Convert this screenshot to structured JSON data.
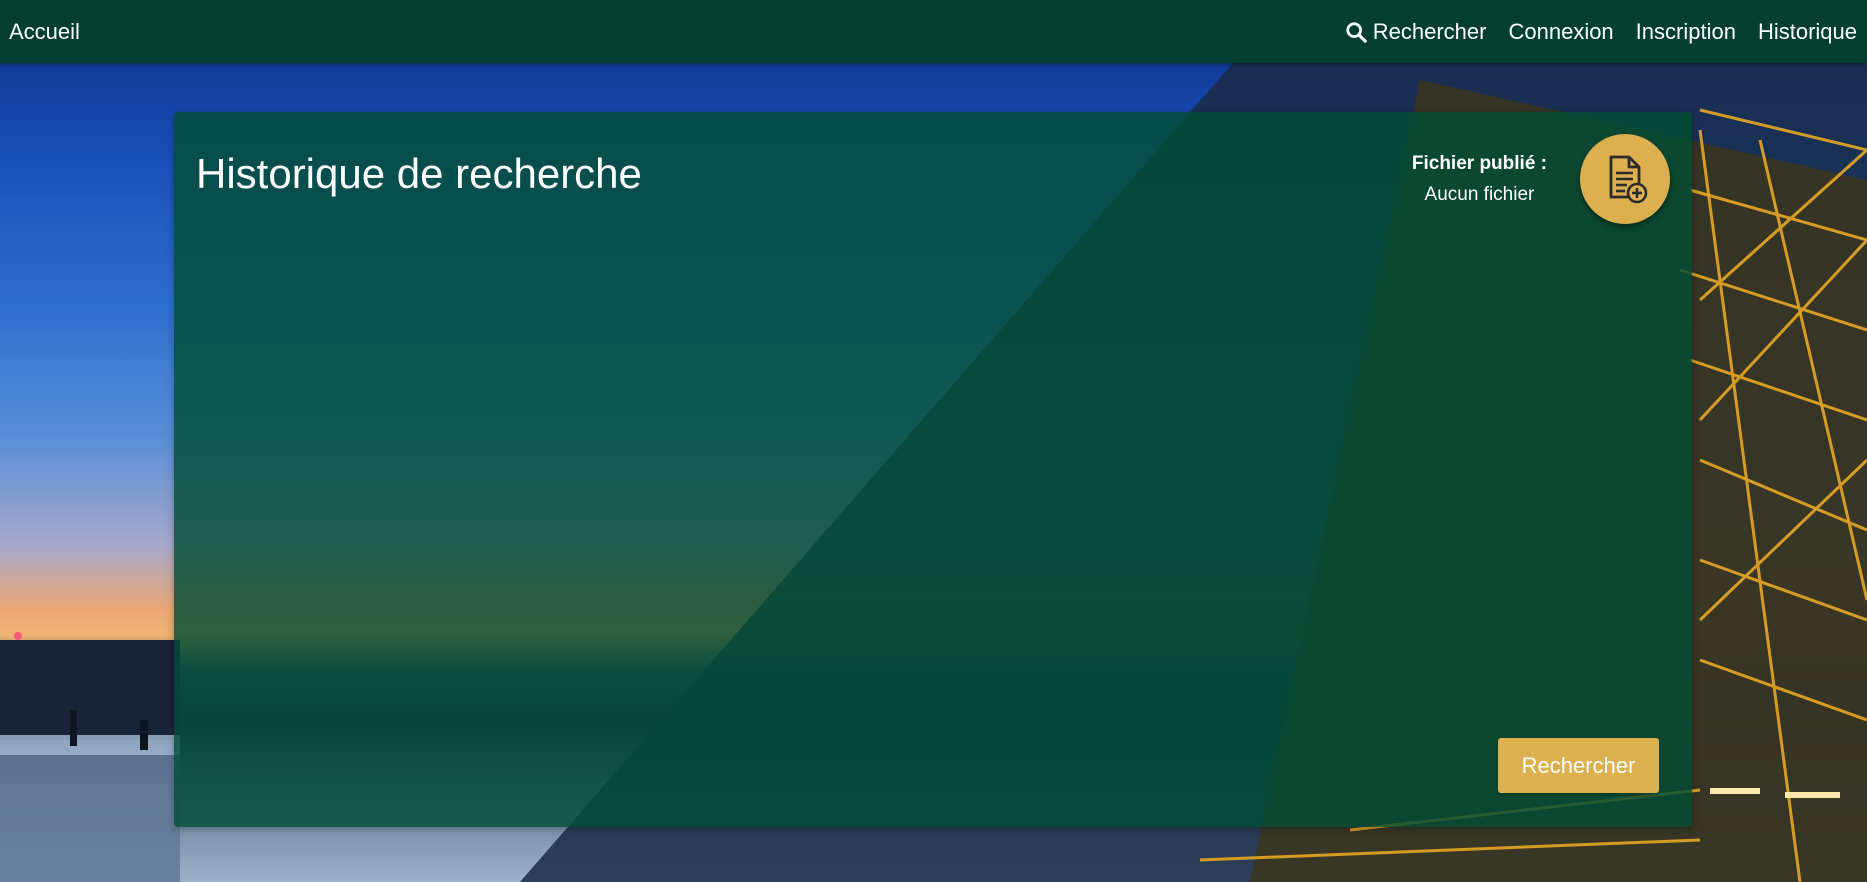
{
  "navbar": {
    "home_label": "Accueil",
    "search_label": "Rechercher",
    "login_label": "Connexion",
    "signup_label": "Inscription",
    "history_label": "Historique"
  },
  "panel": {
    "title": "Historique de recherche",
    "file_label": "Fichier publié :",
    "file_value": "Aucun fichier",
    "search_button_label": "Rechercher"
  },
  "icons": {
    "search": "search-icon",
    "upload": "document-add-icon"
  },
  "colors": {
    "navbar_bg": "#023f2e",
    "panel_bg": "#024d34",
    "accent_gold": "#dcb04f",
    "text": "#ffffff"
  }
}
